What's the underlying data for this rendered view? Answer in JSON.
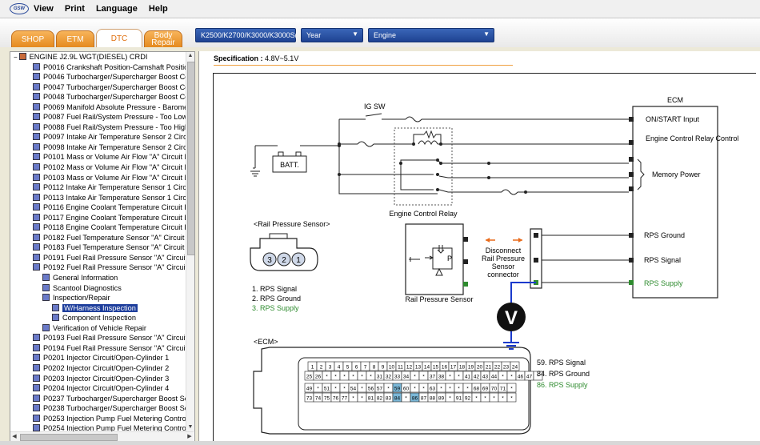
{
  "menu": {
    "items": [
      "View",
      "Print",
      "Language",
      "Help"
    ]
  },
  "tabs": [
    {
      "label": "SHOP",
      "active": false
    },
    {
      "label": "ETM",
      "active": false
    },
    {
      "label": "DTC",
      "active": true
    },
    {
      "label": "Body Repair",
      "active": false
    }
  ],
  "selectors": {
    "model": "K2500/K2700/K3000/K3000S(",
    "year": "Year",
    "system": "Engine"
  },
  "tree": {
    "root": "ENGINE J2.9L WGT(DIESEL) CRDI",
    "items": [
      {
        "label": "P0016 Crankshaft Position-Camshaft Position",
        "level": 1,
        "selected": false
      },
      {
        "label": "P0046 Turbocharger/Supercharger Boost Cc",
        "level": 1,
        "selected": false
      },
      {
        "label": "P0047 Turbocharger/Supercharger Boost Cc",
        "level": 1,
        "selected": false
      },
      {
        "label": "P0048 Turbocharger/Supercharger Boost Cc",
        "level": 1,
        "selected": false
      },
      {
        "label": "P0069 Manifold Absolute Pressure - Baromet",
        "level": 1,
        "selected": false
      },
      {
        "label": "P0087 Fuel Rail/System Pressure - Too Low",
        "level": 1,
        "selected": false
      },
      {
        "label": "P0088 Fuel Rail/System Pressure - Too High",
        "level": 1,
        "selected": false
      },
      {
        "label": "P0097 Intake Air Temperature Sensor 2 Circ",
        "level": 1,
        "selected": false
      },
      {
        "label": "P0098 Intake Air Temperature Sensor 2 Circ",
        "level": 1,
        "selected": false
      },
      {
        "label": "P0101 Mass or Volume Air Flow \"A\" Circuit R",
        "level": 1,
        "selected": false
      },
      {
        "label": "P0102 Mass or Volume Air Flow \"A\" Circuit L",
        "level": 1,
        "selected": false
      },
      {
        "label": "P0103 Mass or Volume Air Flow \"A\" Circuit H",
        "level": 1,
        "selected": false
      },
      {
        "label": "P0112 Intake Air Temperature Sensor 1 Circ",
        "level": 1,
        "selected": false
      },
      {
        "label": "P0113 Intake Air Temperature Sensor 1 Circ",
        "level": 1,
        "selected": false
      },
      {
        "label": "P0116 Engine Coolant Temperature Circuit R",
        "level": 1,
        "selected": false
      },
      {
        "label": "P0117 Engine Coolant Temperature Circuit L",
        "level": 1,
        "selected": false
      },
      {
        "label": "P0118 Engine Coolant Temperature Circuit H",
        "level": 1,
        "selected": false
      },
      {
        "label": "P0182 Fuel Temperature Sensor \"A\" Circuit L",
        "level": 1,
        "selected": false
      },
      {
        "label": "P0183 Fuel Temperature Sensor \"A\" Circuit H",
        "level": 1,
        "selected": false
      },
      {
        "label": "P0191 Fuel Rail Pressure Sensor \"A\" Circuit",
        "level": 1,
        "selected": false
      },
      {
        "label": "P0192 Fuel Rail Pressure Sensor \"A\" Circuit",
        "level": 1,
        "selected": false
      },
      {
        "label": "General Information",
        "level": 2,
        "selected": false
      },
      {
        "label": "Scantool Diagnostics",
        "level": 2,
        "selected": false
      },
      {
        "label": "Inspection/Repair",
        "level": 2,
        "selected": false
      },
      {
        "label": "W/Harness Inspection",
        "level": 3,
        "selected": true
      },
      {
        "label": "Component Inspection",
        "level": 3,
        "selected": false
      },
      {
        "label": "Verification of Vehicle Repair",
        "level": 2,
        "selected": false
      },
      {
        "label": "P0193 Fuel Rail Pressure Sensor \"A\" Circuit",
        "level": 1,
        "selected": false
      },
      {
        "label": "P0194 Fuel Rail Pressure Sensor \"A\" Circuit",
        "level": 1,
        "selected": false
      },
      {
        "label": "P0201 Injector Circuit/Open-Cylinder 1",
        "level": 1,
        "selected": false
      },
      {
        "label": "P0202 Injector Circuit/Open-Cylinder 2",
        "level": 1,
        "selected": false
      },
      {
        "label": "P0203 Injector Circuit/Open-Cylinder 3",
        "level": 1,
        "selected": false
      },
      {
        "label": "P0204 Injector Circuit/Open-Cylinder 4",
        "level": 1,
        "selected": false
      },
      {
        "label": "P0237 Turbocharger/Supercharger Boost Se",
        "level": 1,
        "selected": false
      },
      {
        "label": "P0238 Turbocharger/Supercharger Boost Se",
        "level": 1,
        "selected": false
      },
      {
        "label": "P0253 Injection Pump Fuel Metering Control",
        "level": 1,
        "selected": false
      },
      {
        "label": "P0254 Injection Pump Fuel Metering Control",
        "level": 1,
        "selected": false
      }
    ]
  },
  "spec": {
    "label": "Specification :",
    "value": "4.8V~5.1V"
  },
  "diagram": {
    "ecm_title": "ECM",
    "ig_sw": "IG SW",
    "batt": "BATT.",
    "relay_label": "Engine Control Relay",
    "ecm_pins": [
      "ON/START Input",
      "Engine Control Relay Control",
      "Memory Power",
      "RPS Ground",
      "RPS Signal",
      "RPS Supply"
    ],
    "sensor_title": "<Rail Pressure Sensor>",
    "sensor_pins": [
      "3",
      "2",
      "1"
    ],
    "sensor_legend": [
      "1. RPS Signal",
      "2. RPS Ground",
      "3. RPS Supply"
    ],
    "rps_label": "Rail Pressure Sensor",
    "sensor_p": "P",
    "disconnect_label": "Disconnect Rail Pressure Sensor connector",
    "voltmeter": "V",
    "ecm_conn_title": "<ECM>",
    "ecm_legend": [
      "59. RPS Signal",
      "84. RPS Ground",
      "86. RPS Supply"
    ],
    "ecm_rows": [
      [
        "1",
        "2",
        "3",
        "4",
        "5",
        "6",
        "7",
        "8",
        "9",
        "10",
        "11",
        "12",
        "13",
        "14",
        "15",
        "16",
        "17",
        "18",
        "19",
        "20",
        "21",
        "22",
        "23",
        "24"
      ],
      [
        "25",
        "26",
        "*",
        "*",
        "*",
        "*",
        "*",
        "*",
        "31",
        "32",
        "33",
        "34",
        "*",
        "*",
        "37",
        "38",
        "*",
        "*",
        "41",
        "42",
        "43",
        "44",
        "*",
        "*",
        "46",
        "47",
        "*"
      ],
      [
        "49",
        "*",
        "51",
        "*",
        "*",
        "54",
        "*",
        "56",
        "57",
        "*",
        "59",
        "60",
        "*",
        "*",
        "63",
        "*",
        "*",
        "*",
        "*",
        "68",
        "69",
        "70",
        "71",
        "*"
      ],
      [
        "73",
        "74",
        "75",
        "76",
        "77",
        "*",
        "*",
        "81",
        "82",
        "83",
        "84",
        "*",
        "86",
        "87",
        "88",
        "89",
        "*",
        "91",
        "92",
        "*",
        "*",
        "*",
        "*",
        "*"
      ]
    ],
    "highlight_pins": [
      "59",
      "84",
      "86"
    ],
    "colors": {
      "supply": "#2e8b2e",
      "wire_blue": "#1a3acc",
      "arrow": "#e86a1a",
      "highlight": "#7bb8d8"
    }
  }
}
